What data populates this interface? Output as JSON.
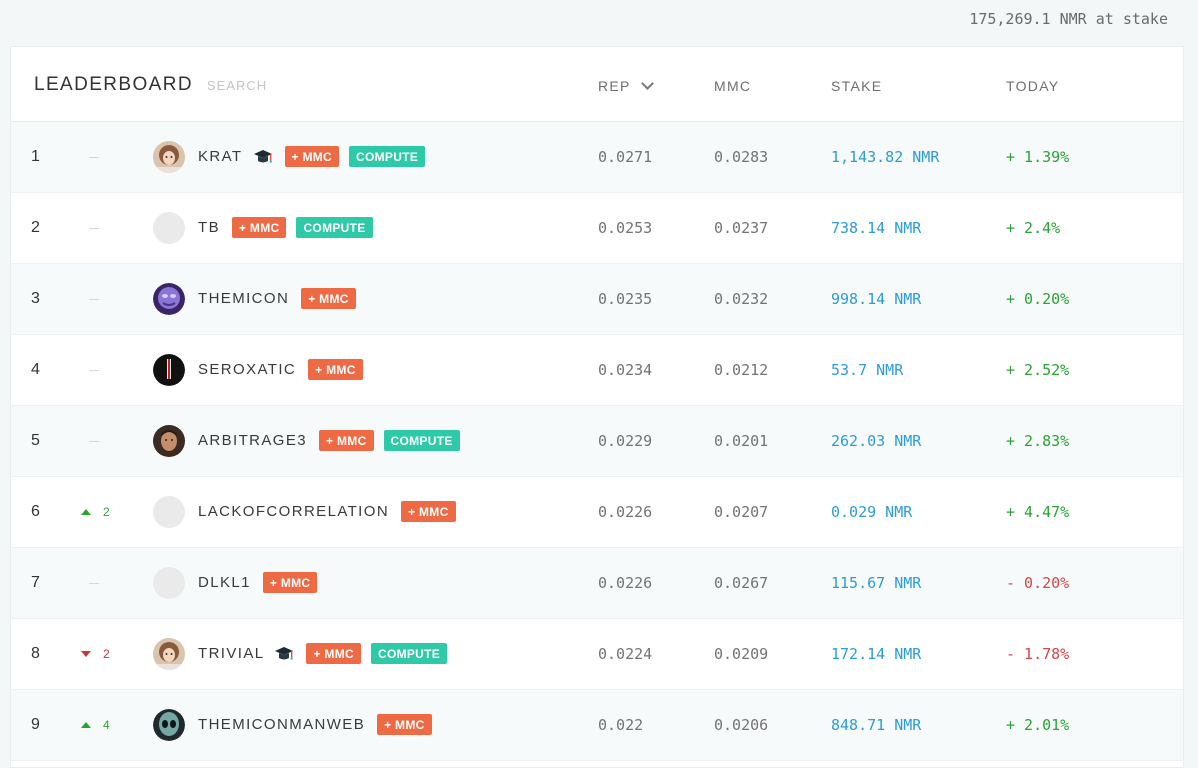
{
  "header_total": "175,269.1 NMR at stake",
  "table": {
    "title": "LEADERBOARD",
    "search_placeholder": "SEARCH",
    "columns": {
      "rep": "REP",
      "mmc": "MMC",
      "stake": "STAKE",
      "today": "TODAY"
    }
  },
  "rows": [
    {
      "rank": "1",
      "delta": "",
      "delta_dir": "none",
      "avatar": "photo-girl",
      "name": "KRAT",
      "hat": true,
      "mmc_badge": "+ MMC",
      "compute_badge": "COMPUTE",
      "rep": "0.0271",
      "mmc": "0.0283",
      "stake": "1,143.82 NMR",
      "today": "+ 1.39%",
      "today_sign": "pos"
    },
    {
      "rank": "2",
      "delta": "",
      "delta_dir": "none",
      "avatar": "blank",
      "name": "TB",
      "hat": false,
      "mmc_badge": "+ MMC",
      "compute_badge": "COMPUTE",
      "rep": "0.0253",
      "mmc": "0.0237",
      "stake": "738.14 NMR",
      "today": "+ 2.4%",
      "today_sign": "pos"
    },
    {
      "rank": "3",
      "delta": "",
      "delta_dir": "none",
      "avatar": "purple-orb",
      "name": "THEMICON",
      "hat": false,
      "mmc_badge": "+ MMC",
      "compute_badge": "",
      "rep": "0.0235",
      "mmc": "0.0232",
      "stake": "998.14 NMR",
      "today": "+ 0.20%",
      "today_sign": "pos"
    },
    {
      "rank": "4",
      "delta": "",
      "delta_dir": "none",
      "avatar": "dark-figure",
      "name": "SEROXATIC",
      "hat": false,
      "mmc_badge": "+ MMC",
      "compute_badge": "",
      "rep": "0.0234",
      "mmc": "0.0212",
      "stake": "53.7 NMR",
      "today": "+ 2.52%",
      "today_sign": "pos"
    },
    {
      "rank": "5",
      "delta": "",
      "delta_dir": "none",
      "avatar": "photo-man",
      "name": "ARBITRAGE3",
      "hat": false,
      "mmc_badge": "+ MMC",
      "compute_badge": "COMPUTE",
      "rep": "0.0229",
      "mmc": "0.0201",
      "stake": "262.03 NMR",
      "today": "+ 2.83%",
      "today_sign": "pos"
    },
    {
      "rank": "6",
      "delta": "2",
      "delta_dir": "up",
      "avatar": "blank",
      "name": "LACKOFCORRELATION",
      "hat": false,
      "mmc_badge": "+ MMC",
      "compute_badge": "",
      "rep": "0.0226",
      "mmc": "0.0207",
      "stake": "0.029 NMR",
      "today": "+ 4.47%",
      "today_sign": "pos"
    },
    {
      "rank": "7",
      "delta": "",
      "delta_dir": "none",
      "avatar": "blank",
      "name": "DLKL1",
      "hat": false,
      "mmc_badge": "+ MMC",
      "compute_badge": "",
      "rep": "0.0226",
      "mmc": "0.0267",
      "stake": "115.67 NMR",
      "today": "- 0.20%",
      "today_sign": "neg"
    },
    {
      "rank": "8",
      "delta": "2",
      "delta_dir": "down",
      "avatar": "photo-girl",
      "name": "TRIVIAL",
      "hat": true,
      "mmc_badge": "+ MMC",
      "compute_badge": "COMPUTE",
      "rep": "0.0224",
      "mmc": "0.0209",
      "stake": "172.14 NMR",
      "today": "- 1.78%",
      "today_sign": "neg"
    },
    {
      "rank": "9",
      "delta": "4",
      "delta_dir": "up",
      "avatar": "alien",
      "name": "THEMICONMANWEB",
      "hat": false,
      "mmc_badge": "+ MMC",
      "compute_badge": "",
      "rep": "0.022",
      "mmc": "0.0206",
      "stake": "848.71 NMR",
      "today": "+ 2.01%",
      "today_sign": "pos"
    }
  ],
  "colors": {
    "mmc_badge": "#ee6a44",
    "compute_badge": "#2ec9a7",
    "stake": "#2c9cd6",
    "positive": "#2aa334",
    "negative": "#d24747"
  }
}
